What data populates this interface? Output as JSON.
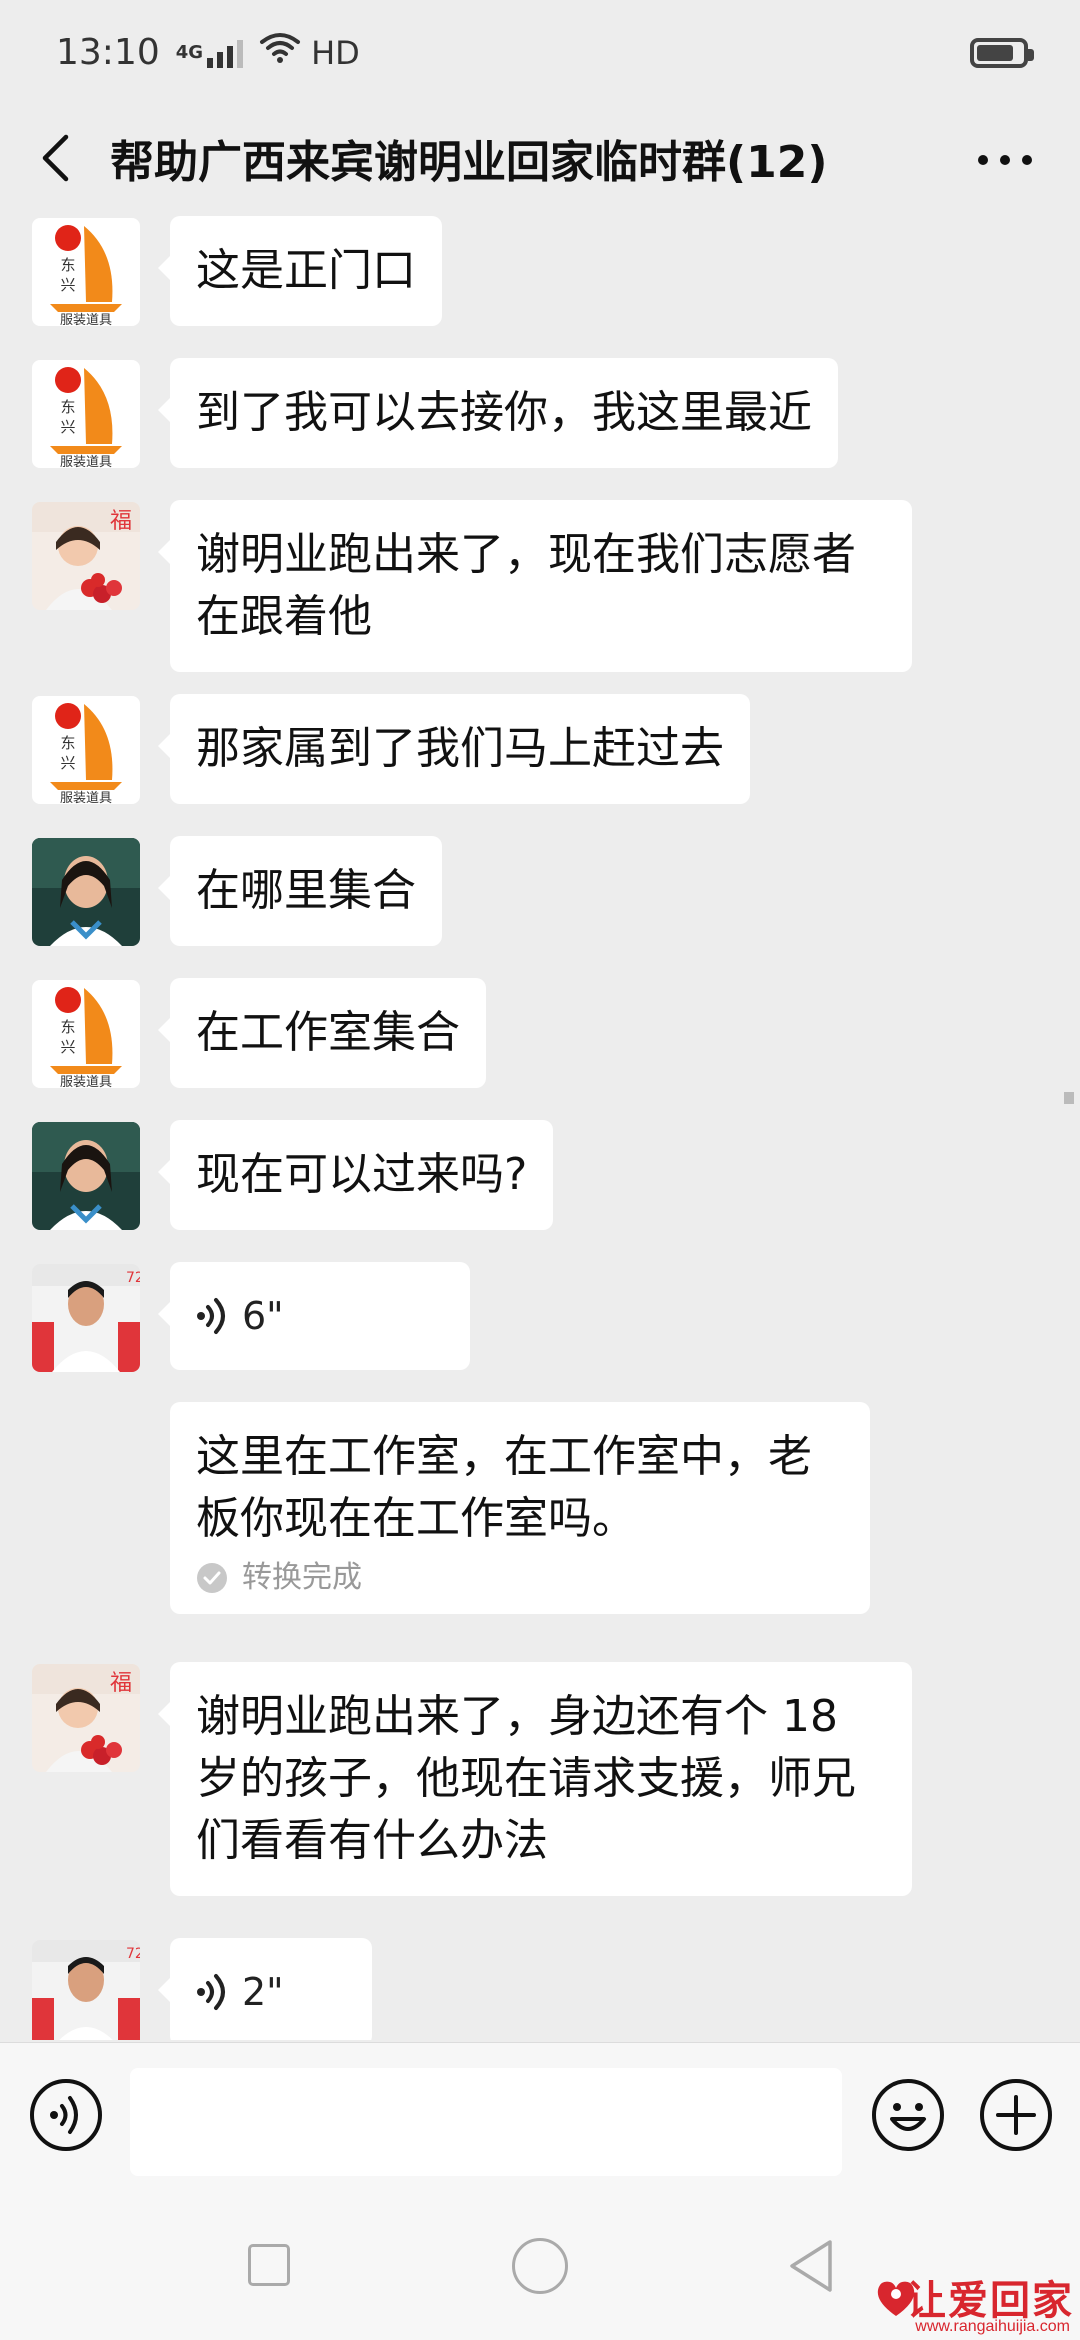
{
  "status_bar": {
    "time": "13:10",
    "network": "4G",
    "quality": "HD"
  },
  "header": {
    "title": "帮助广西来宾谢明业回家临时群(12)"
  },
  "messages": [
    {
      "sender_avatar": "dongxing-logo-avatar",
      "type": "text",
      "text": "这是正门口"
    },
    {
      "sender_avatar": "dongxing-logo-avatar",
      "type": "text",
      "text": "到了我可以去接你，我这里最近"
    },
    {
      "sender_avatar": "woman-with-flowers-avatar",
      "type": "text",
      "text": "谢明业跑出来了，现在我们志愿者在跟着他"
    },
    {
      "sender_avatar": "dongxing-logo-avatar",
      "type": "text",
      "text": "那家属到了我们马上赶过去"
    },
    {
      "sender_avatar": "woman-portrait-avatar",
      "type": "text",
      "text": "在哪里集合"
    },
    {
      "sender_avatar": "dongxing-logo-avatar",
      "type": "text",
      "text": "在工作室集合"
    },
    {
      "sender_avatar": "woman-portrait-avatar",
      "type": "text",
      "text": "现在可以过来吗?"
    },
    {
      "sender_avatar": "man-portrait-avatar",
      "type": "voice",
      "duration": "6\""
    },
    {
      "type": "voice-transcript",
      "text": "这里在工作室，在工作室中，老板你现在在工作室吗。",
      "status": "转换完成"
    },
    {
      "sender_avatar": "woman-with-flowers-avatar",
      "type": "text",
      "text": "谢明业跑出来了，身边还有个 18 岁的孩子，他现在请求支援，师兄们看看有什么办法"
    },
    {
      "sender_avatar": "man-portrait-avatar",
      "type": "voice",
      "duration": "2\""
    }
  ],
  "logo_avatar": {
    "line1": "东",
    "line2": "兴",
    "caption": "服装道具"
  },
  "input": {
    "placeholder": ""
  },
  "watermark": {
    "text": "让爱回家",
    "url": "www.rangaihuijia.com"
  },
  "colors": {
    "background": "#ededed",
    "bubble": "#ffffff",
    "logo_orange": "#f28a1a",
    "logo_red": "#e02418",
    "watermark_red": "#d8262e"
  }
}
